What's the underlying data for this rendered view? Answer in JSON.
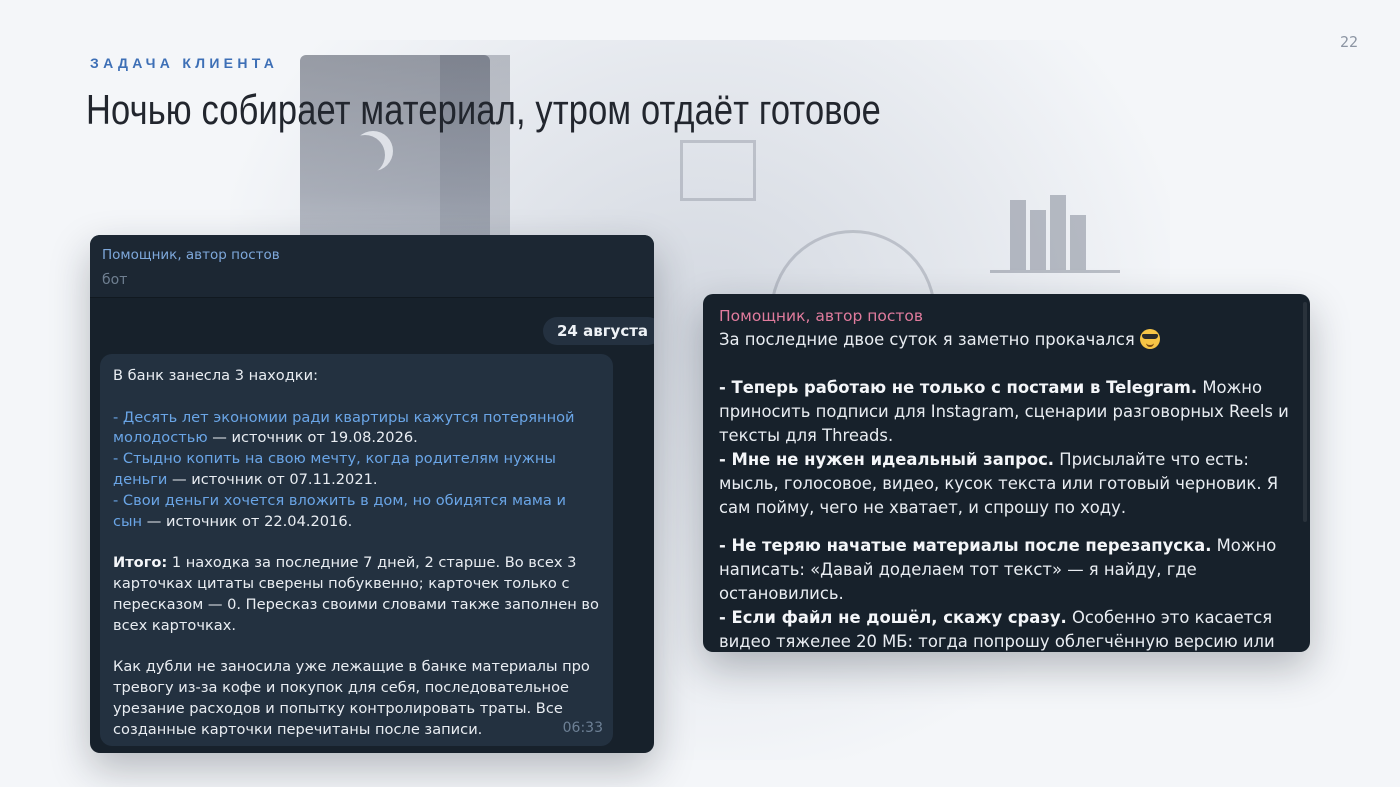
{
  "page": {
    "number": "22",
    "eyebrow": "ЗАДАЧА КЛИЕНТА",
    "title": "Ночью собирает материал, утром отдаёт готовое"
  },
  "left_chat": {
    "name": "Помощник, автор постов",
    "status": "бот",
    "date": "24 августа",
    "message": {
      "intro": "В банк занесла 3 находки:",
      "items": [
        {
          "link": "- Десять лет экономии ради квартиры кажутся потерянной молодостью",
          "rest": " — источник от 19.08.2026."
        },
        {
          "link": "- Стыдно копить на свою мечту, когда родителям нужны деньги",
          "rest": " — источник от 07.11.2021."
        },
        {
          "link": "- Свои деньги хочется вложить в дом, но обидятся мама и сын",
          "rest": " — источник от 22.04.2016."
        }
      ],
      "summary_label": "Итого:",
      "summary_text": " 1 находка за последние 7 дней, 2 старше. Во всех 3 карточках цитаты сверены побуквенно; карточек только с пересказом — 0. Пересказ своими словами также заполнен во всех карточках.",
      "closing": "Как дубли не заносила уже лежащие в банке материалы про тревогу из-за кофе и покупок для себя, последовательное урезание расходов и попытку контролировать траты. Все созданные карточки перечитаны после записи.",
      "time": "06:33"
    }
  },
  "right_chat": {
    "name": "Помощник, автор постов",
    "intro": "За последние двое суток я заметно прокачался",
    "emoji": "smiling-face-with-sunglasses-icon",
    "points": [
      {
        "bold": "- Теперь работаю не только с постами в Telegram.",
        "text": " Можно приносить подписи для Instagram, сценарии разговорных Reels и тексты для Threads."
      },
      {
        "bold": "- Мне не нужен идеальный запрос.",
        "text": " Присылайте что есть: мысль, голосовое, видео, кусок текста или готовый черновик. Я сам пойму, чего не хватает, и спрошу по ходу."
      },
      {
        "bold": "- Не теряю начатые материалы после перезапуска.",
        "text": " Можно написать: «Давай доделаем тот текст» — я найду, где остановились."
      },
      {
        "bold": "- Если файл не дошёл, скажу сразу.",
        "text": " Особенно это касается видео тяжелее 20 МБ: тогда попрошу облегчённую версию или"
      }
    ]
  },
  "colors": {
    "accent": "#3d6fb6",
    "card_bg": "#17212b",
    "bubble_bg": "#233140",
    "link": "#6aa5e6",
    "right_name": "#e07b9d"
  }
}
